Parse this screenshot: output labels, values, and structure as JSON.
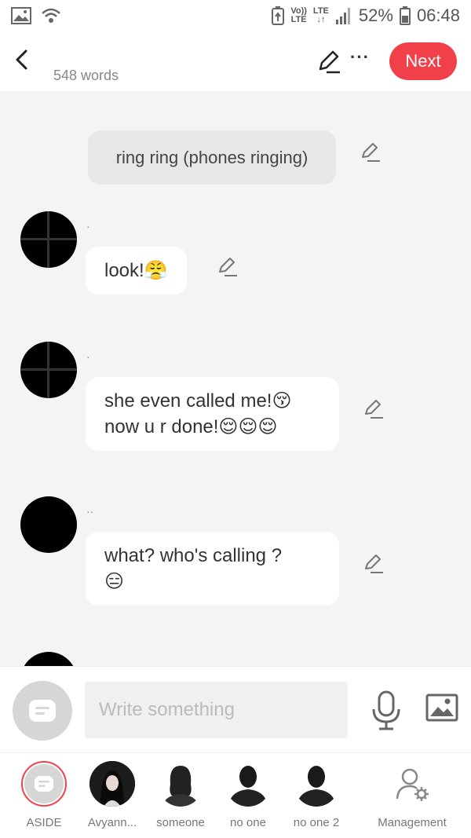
{
  "status_bar": {
    "network_top": "Vo))",
    "network_bottom": "LTE",
    "lte_top": "LTE",
    "battery": "52%",
    "time": "06:48"
  },
  "header": {
    "word_count": "548 words",
    "next_label": "Next",
    "more_label": "···"
  },
  "messages": {
    "narration": "ring ring (phones ringing)",
    "m1": {
      "speaker": "·",
      "text": "look!😤"
    },
    "m2": {
      "speaker": "·",
      "text": "she even called me!😚\nnow u r done!😌😌😌"
    },
    "m3": {
      "speaker": "··",
      "text": "what? who's calling ?\n😑"
    }
  },
  "input": {
    "placeholder": "Write something"
  },
  "characters": [
    {
      "label": "ASIDE"
    },
    {
      "label": "Avyann..."
    },
    {
      "label": "someone"
    },
    {
      "label": "no one"
    },
    {
      "label": "no one 2"
    },
    {
      "label": "Management"
    }
  ],
  "colors": {
    "accent": "#f2404a",
    "chat_background": "#f4f4f4",
    "narration_background": "#e8e8e8"
  }
}
